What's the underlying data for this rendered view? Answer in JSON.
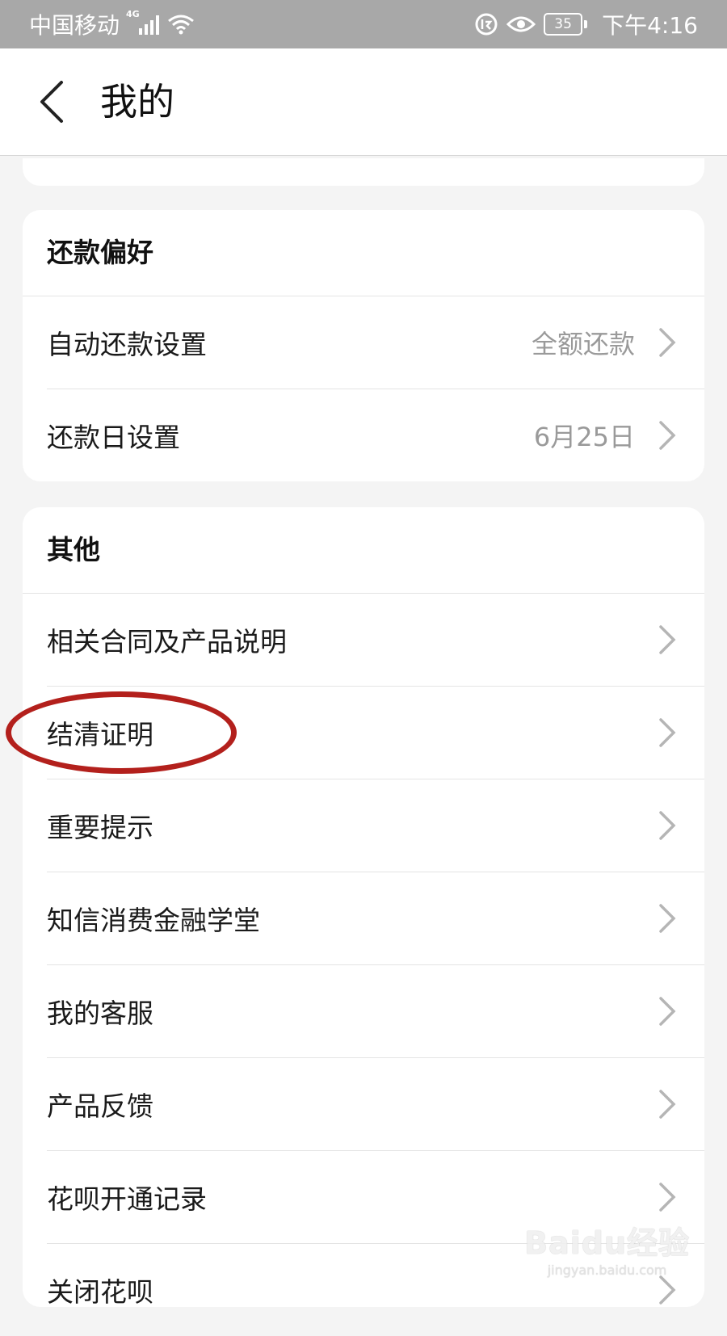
{
  "status_bar": {
    "carrier": "中国移动",
    "network": "4G",
    "battery": "35",
    "time": "下午4:16"
  },
  "header": {
    "title": "我的"
  },
  "repayment_section": {
    "title": "还款偏好",
    "items": [
      {
        "label": "自动还款设置",
        "value": "全额还款"
      },
      {
        "label": "还款日设置",
        "value": "6月25日"
      }
    ]
  },
  "other_section": {
    "title": "其他",
    "items": [
      {
        "label": "相关合同及产品说明"
      },
      {
        "label": "结清证明"
      },
      {
        "label": "重要提示"
      },
      {
        "label": "知信消费金融学堂"
      },
      {
        "label": "我的客服"
      },
      {
        "label": "产品反馈"
      },
      {
        "label": "花呗开通记录"
      },
      {
        "label": "关闭花呗"
      }
    ]
  },
  "annotation": {
    "target": "结清证明",
    "color": "#b3201c"
  },
  "watermark": {
    "main": "Baidu经验",
    "sub": "jingyan.baidu.com"
  }
}
